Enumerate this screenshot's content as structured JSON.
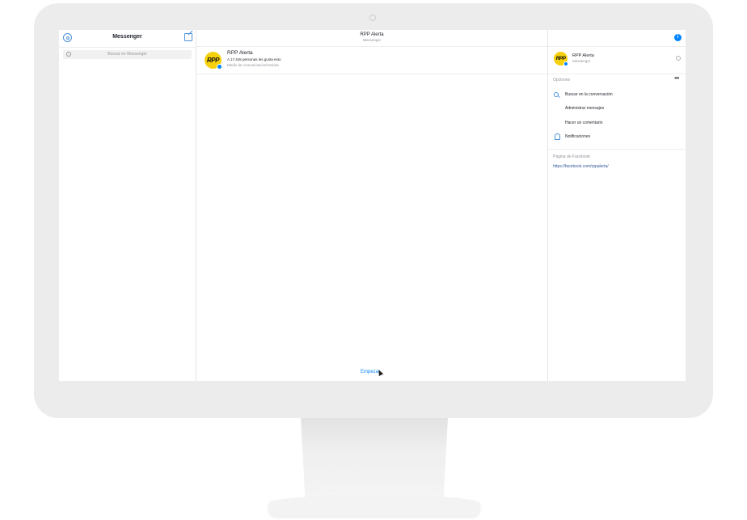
{
  "sidebar": {
    "title": "Messenger",
    "search_placeholder": "Buscar en Messenger"
  },
  "conversation": {
    "title": "RPP Alerta",
    "subtitle": "Messenger",
    "page_card": {
      "name": "RPP Alerta",
      "likes": "A 17.445 personas les gusta esto",
      "category": "Medio de comunicación/noticias",
      "logo": "RPP"
    },
    "start_button": "Empezar"
  },
  "details": {
    "name": "RPP Alerta",
    "subtitle": "Messenger",
    "logo": "RPP",
    "options_title": "Opciones",
    "more_label": "•••",
    "options": [
      {
        "label": "Buscar en la conversación",
        "icon": "search-icon"
      },
      {
        "label": "Administrar mensajes",
        "icon": ""
      },
      {
        "label": "Hacer un comentario",
        "icon": ""
      },
      {
        "label": "Notificaciones",
        "icon": "bell-icon"
      }
    ],
    "facebook_page_title": "Página de Facebook",
    "facebook_page_link": "https://facebook.com/rppalerta/"
  },
  "info_icon_label": "i",
  "colors": {
    "accent": "#0084ff",
    "logo_yellow": "#f5d10d",
    "monitor_bezel": "#ececec"
  }
}
